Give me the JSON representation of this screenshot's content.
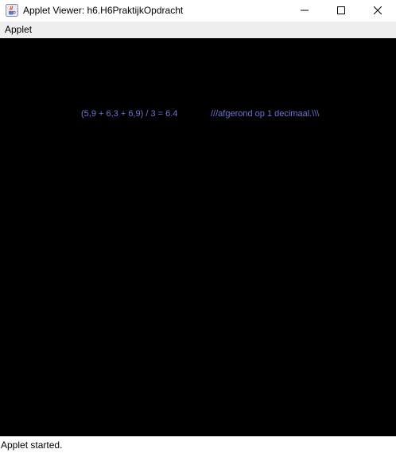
{
  "window": {
    "title": "Applet Viewer: h6.H6PraktijkOpdracht",
    "icon": "java-coffee-cup-icon",
    "controls": {
      "minimize_icon": "minimize-icon",
      "maximize_icon": "maximize-icon",
      "close_icon": "close-icon"
    }
  },
  "menubar": {
    "items": [
      {
        "label": "Applet"
      }
    ]
  },
  "applet": {
    "background": "#000000",
    "text_color": "#6b74d6",
    "formula": "(5,9 + 6,3 + 6,9) / 3 = 6.4",
    "note": "///afgerond op 1 decimaal.\\\\\\"
  },
  "status": {
    "text": "Applet started."
  }
}
